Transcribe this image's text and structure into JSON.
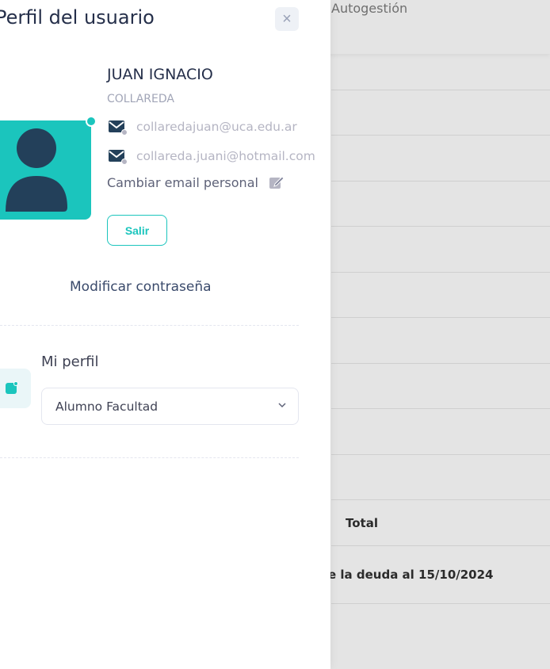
{
  "background": {
    "header_crumb": "Autogestión",
    "table_rows": [
      {
        "text": ""
      },
      {
        "text": ""
      },
      {
        "text": ""
      },
      {
        "text": ""
      },
      {
        "text": ""
      },
      {
        "text": ""
      },
      {
        "text": ""
      },
      {
        "text": ""
      },
      {
        "text": ""
      },
      {
        "text": ""
      },
      {
        "text": "Total"
      },
      {
        "text": "e la deuda al 15/10/2024"
      }
    ]
  },
  "drawer": {
    "title": "Perfil del usuario",
    "close_icon": "×",
    "user": {
      "name": "JUAN IGNACIO",
      "surname": "COLLAREDA",
      "email_institutional": "collaredajuan@uca.edu.ar",
      "email_personal": "collareda.juani@hotmail.com",
      "change_email_label": "Cambiar email personal"
    },
    "logout_label": "Salir",
    "change_password_label": "Modificar contraseña",
    "profile": {
      "label": "Mi perfil",
      "selected": "Alumno Facultad"
    }
  },
  "colors": {
    "accent": "#1bc5bd",
    "avatar_figure": "#23405a",
    "mail_icon": "#23405a"
  },
  "icons": [
    "close-icon",
    "avatar-icon",
    "mail-icon",
    "edit-icon",
    "profile-icon",
    "chevron-down-icon"
  ]
}
